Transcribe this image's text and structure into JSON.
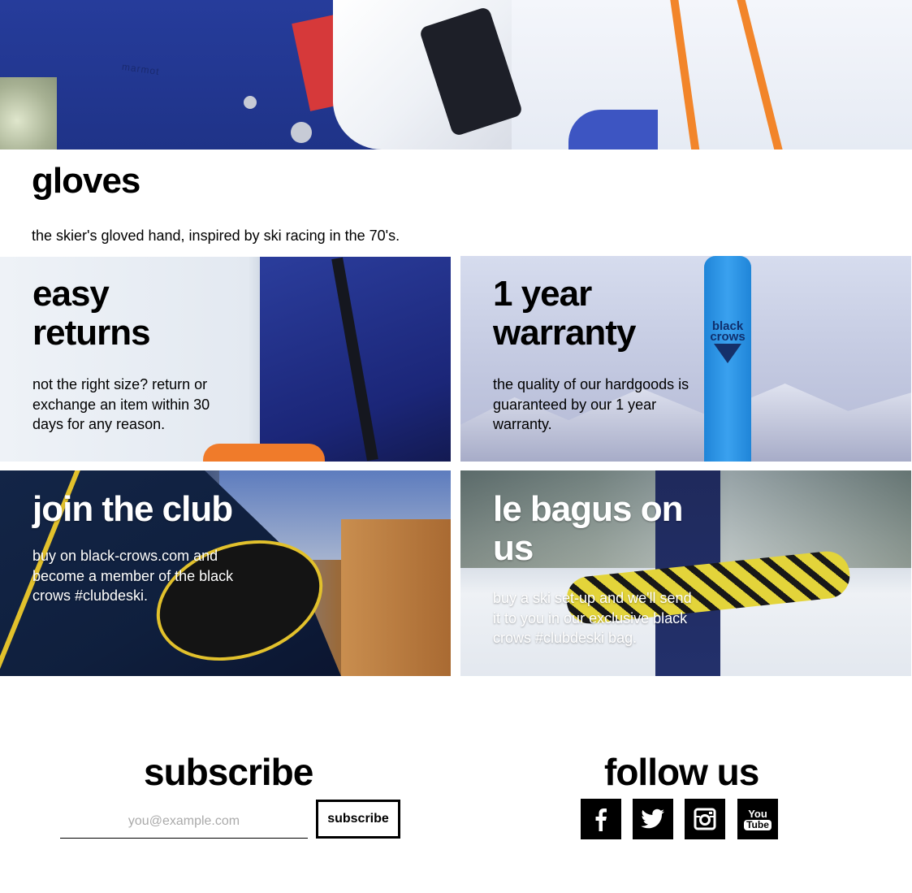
{
  "hero": {
    "brand_text": "marmot"
  },
  "intro": {
    "title": "gloves",
    "subtitle": "the skier's gloved hand, inspired by ski racing in the 70's."
  },
  "tiles": [
    {
      "heading_line1": "easy",
      "heading_line2": "returns",
      "body_line1": "not the right size? return or",
      "body_line2": "exchange an item within 30",
      "body_line3": "days for any reason."
    },
    {
      "heading_line1": "1 year",
      "heading_line2": "warranty",
      "body_line1": "the quality of our hardgoods is",
      "body_line2": "guaranteed by our 1 year",
      "body_line3": "warranty.",
      "ski_logo_line1": "black",
      "ski_logo_line2": "crows"
    },
    {
      "heading_line1": "join the club",
      "body_line1": "buy on black-crows.com and",
      "body_line2": "become a member of the black",
      "body_line3": "crows #clubdeski."
    },
    {
      "heading_line1": "le bagus on",
      "heading_line2": "us",
      "body_line1": "buy a ski set-up and we'll send",
      "body_line2": "it to you in our exclusive black",
      "body_line3": "crows #clubdeski bag."
    }
  ],
  "subscribe": {
    "title": "subscribe",
    "email_placeholder": "you@example.com",
    "button_label": "subscribe"
  },
  "follow": {
    "title": "follow us",
    "icons": [
      "facebook-icon",
      "twitter-icon",
      "instagram-icon",
      "youtube-icon"
    ],
    "youtube_you": "You",
    "youtube_tube": "Tube"
  },
  "colors": {
    "text": "#000000",
    "background": "#ffffff",
    "accent_blue": "#263c9b",
    "pole_orange": "#f2852a",
    "ski_blue": "#2f95e6",
    "patch_yellow": "#e2c12c"
  }
}
